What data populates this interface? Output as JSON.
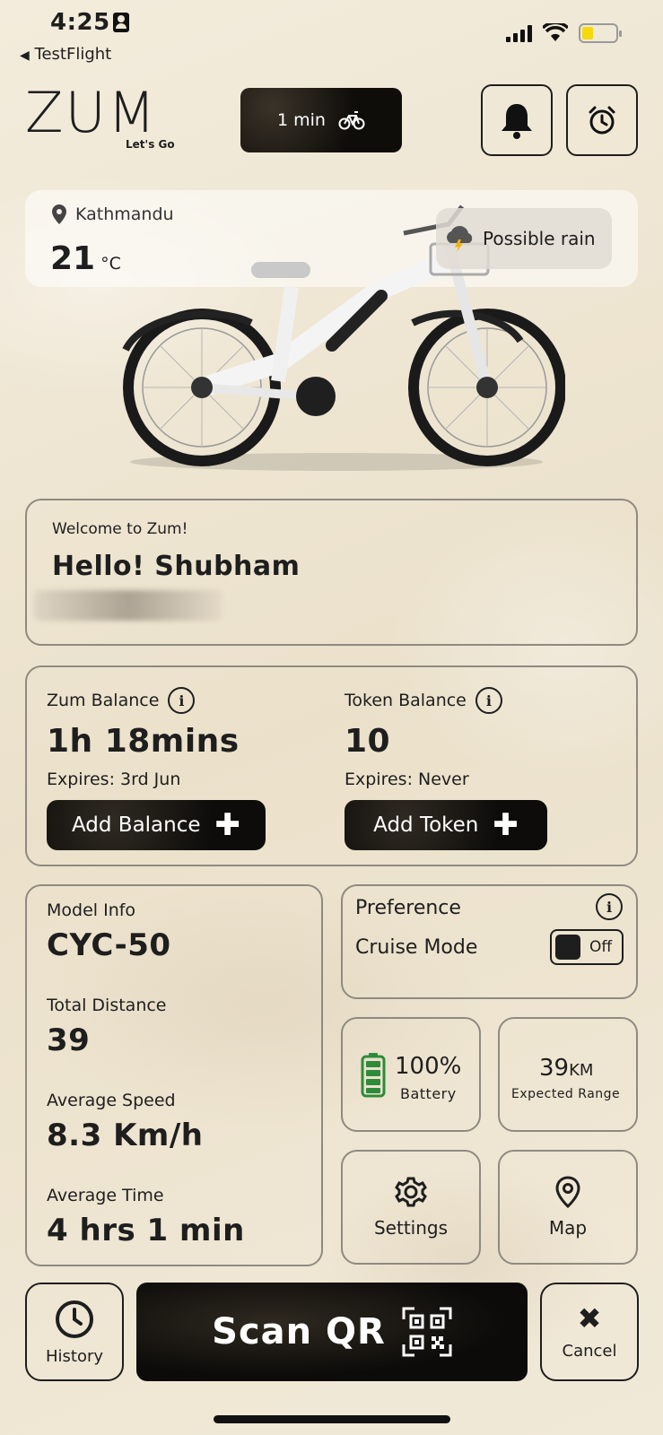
{
  "status": {
    "time": "4:25",
    "back_label": "TestFlight"
  },
  "header": {
    "logo": "ZUM",
    "tagline": "Let's Go",
    "ride_timer": "1 min"
  },
  "weather": {
    "location": "Kathmandu",
    "temperature": "21",
    "unit": "°C",
    "condition": "Possible rain"
  },
  "welcome": {
    "greeting": "Welcome to Zum!",
    "name": "Hello! Shubham"
  },
  "balance": {
    "zum_label": "Zum Balance",
    "zum_value": "1h 18mins",
    "zum_expires": "Expires: 3rd Jun",
    "add_balance": "Add Balance",
    "token_label": "Token Balance",
    "token_value": "10",
    "token_expires": "Expires: Never",
    "add_token": "Add Token"
  },
  "model": {
    "info_label": "Model Info",
    "info_value": "CYC-50",
    "distance_label": "Total Distance",
    "distance_value": "39",
    "speed_label": "Average Speed",
    "speed_value": "8.3 Km/h",
    "time_label": "Average Time",
    "time_value": "4 hrs 1 min"
  },
  "preference": {
    "title": "Preference",
    "cruise_label": "Cruise Mode",
    "cruise_state": "Off"
  },
  "battery": {
    "value": "100%",
    "label": "Battery",
    "level": 100
  },
  "range": {
    "value": "39",
    "unit": "KM",
    "label": "Expected Range"
  },
  "tiles": {
    "settings": "Settings",
    "map": "Map"
  },
  "bottom": {
    "history": "History",
    "scan": "Scan QR",
    "cancel": "Cancel"
  },
  "colors": {
    "battery_green": "#2e8b3a",
    "dark": "#111111",
    "paper": "#efe6d3"
  }
}
